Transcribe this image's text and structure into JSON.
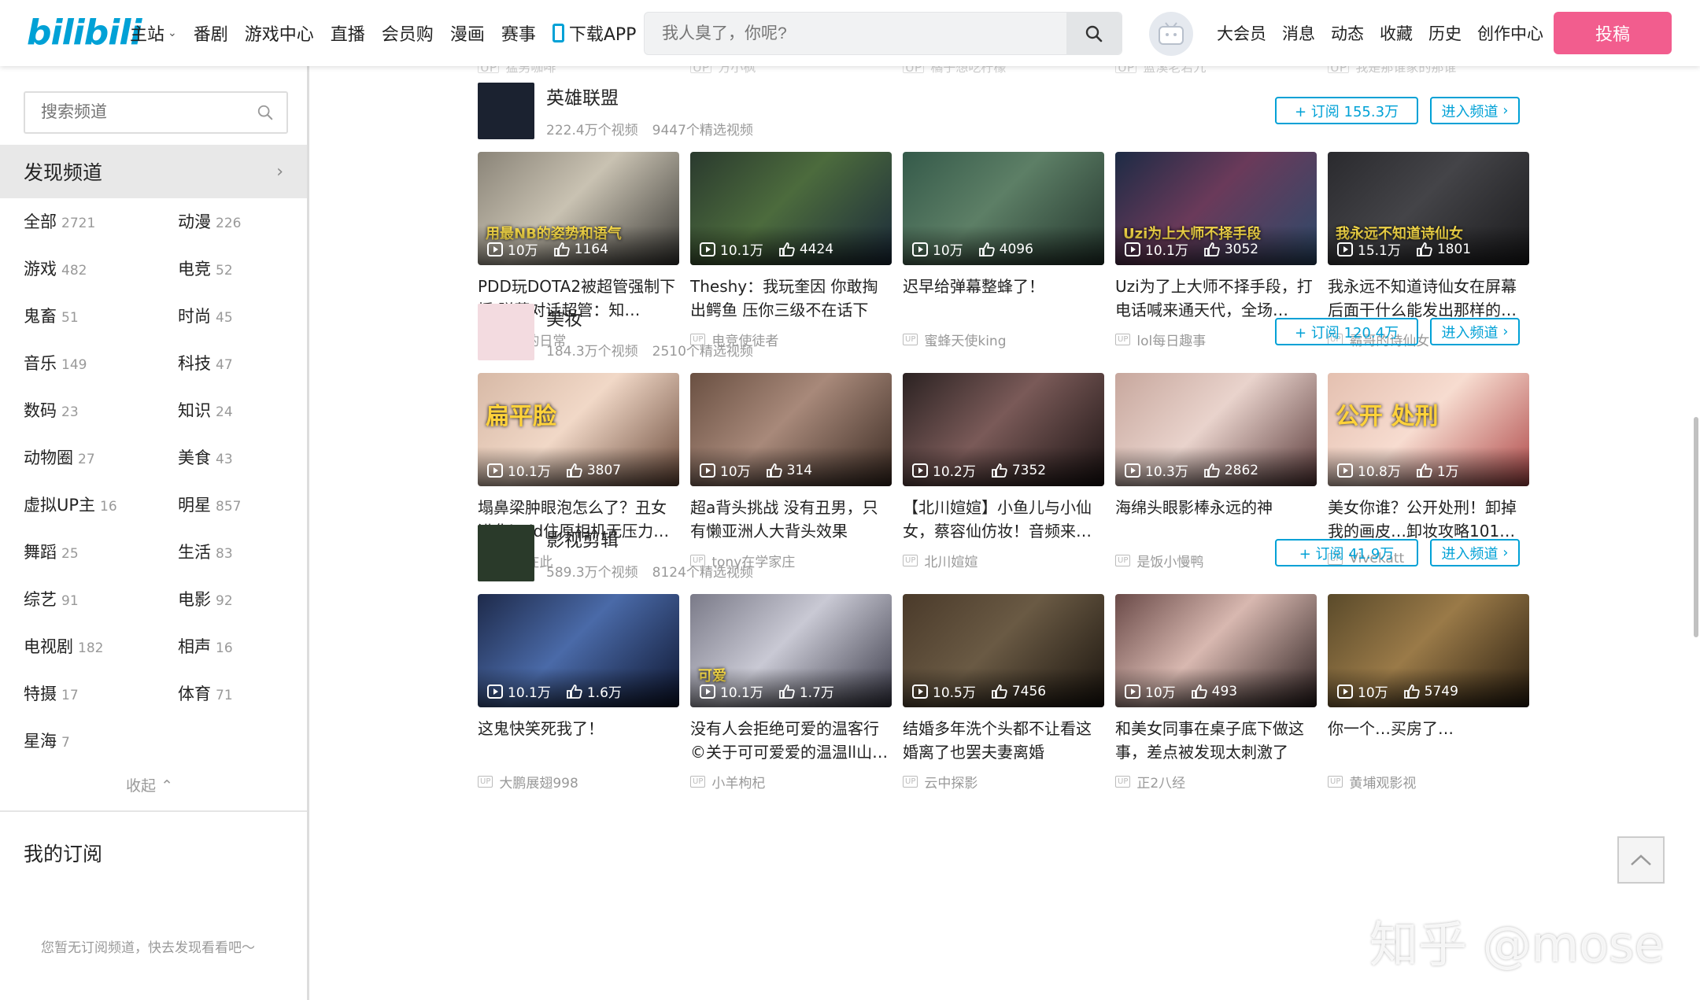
{
  "header": {
    "logo": "bilibili",
    "nav": [
      {
        "label": "主站",
        "dropdown": true
      },
      {
        "label": "番剧"
      },
      {
        "label": "游戏中心"
      },
      {
        "label": "直播"
      },
      {
        "label": "会员购"
      },
      {
        "label": "漫画"
      },
      {
        "label": "赛事"
      },
      {
        "label": "下载APP"
      }
    ],
    "search_placeholder": "我人臭了，你呢?",
    "right_nav": [
      "大会员",
      "消息",
      "动态",
      "收藏",
      "历史",
      "创作中心"
    ],
    "upload_label": "投稿",
    "upload_color": "#f25d8e",
    "accent_color": "#00a1d6"
  },
  "sidebar": {
    "search_placeholder": "搜索频道",
    "discover_label": "发现频道",
    "categories": [
      {
        "name": "全部",
        "count": "2721"
      },
      {
        "name": "动漫",
        "count": "226"
      },
      {
        "name": "游戏",
        "count": "482"
      },
      {
        "name": "电竞",
        "count": "52"
      },
      {
        "name": "鬼畜",
        "count": "51"
      },
      {
        "name": "时尚",
        "count": "45"
      },
      {
        "name": "音乐",
        "count": "149"
      },
      {
        "name": "科技",
        "count": "47"
      },
      {
        "name": "数码",
        "count": "23"
      },
      {
        "name": "知识",
        "count": "24"
      },
      {
        "name": "动物圈",
        "count": "27"
      },
      {
        "name": "美食",
        "count": "43"
      },
      {
        "name": "虚拟UP主",
        "count": "16"
      },
      {
        "name": "明星",
        "count": "857"
      },
      {
        "name": "舞蹈",
        "count": "25"
      },
      {
        "name": "生活",
        "count": "83"
      },
      {
        "name": "综艺",
        "count": "91"
      },
      {
        "name": "电影",
        "count": "92"
      },
      {
        "name": "电视剧",
        "count": "182"
      },
      {
        "name": "相声",
        "count": "16"
      },
      {
        "name": "特摄",
        "count": "17"
      },
      {
        "name": "体育",
        "count": "71"
      },
      {
        "name": "星海",
        "count": "7"
      }
    ],
    "collapse_label": "收起",
    "my_sub_label": "我的订阅",
    "no_sub_text": "您暂无订阅频道，快去发现看看吧～"
  },
  "top_partial_uploaders": [
    "猛男咖啡",
    "方小枫",
    "橘子想吃柠檬",
    "蓝溪老若九",
    "我是那谁家的那谁"
  ],
  "channels": [
    {
      "name": "英雄联盟",
      "videos_count": "222.4万个视频",
      "featured_count": "9447个精选视频",
      "subscribe_label": "+ 订阅 155.3万",
      "enter_label": "进入频道",
      "videos": [
        {
          "views": "10万",
          "likes": "1164",
          "title": "PDD玩DOTA2被超管强制下播 弹幕对话超管：知…",
          "up": "猪酱的日常",
          "caption": "用最NB的姿势和语气"
        },
        {
          "views": "10.1万",
          "likes": "4424",
          "title": "Theshy：我玩奎因 你敢掏出鳄鱼 压你三级不在话下",
          "up": "电竞使徒者",
          "caption": ""
        },
        {
          "views": "10万",
          "likes": "4096",
          "title": "迟早给弹幕整蜂了！",
          "up": "蜜蜂天使king",
          "caption": ""
        },
        {
          "views": "10.1万",
          "likes": "3052",
          "title": "Uzi为了上大师不择手段，打电话喊来通天代，全场…",
          "up": "lol每日趣事",
          "caption": "Uzi为上大师不择手段"
        },
        {
          "views": "15.1万",
          "likes": "1801",
          "title": "我永远不知道诗仙女在屏幕后面干什么能发出那样的…",
          "up": "霸哥的诗仙女",
          "caption": "我永远不知道诗仙女"
        }
      ]
    },
    {
      "name": "美妆",
      "videos_count": "184.3万个视频",
      "featured_count": "2510个精选视频",
      "subscribe_label": "+ 订阅 120.4万",
      "enter_label": "进入频道",
      "videos": [
        {
          "views": "10.1万",
          "likes": "3807",
          "title": "塌鼻梁肿眼泡怎么了？丑女进化hold住原相机无压力…",
          "up": "秀芹在此",
          "caption": "扁平脸"
        },
        {
          "views": "10万",
          "likes": "314",
          "title": "超a背头挑战 没有丑男，只有懒亚洲人大背头效果",
          "up": "tony在学家庄",
          "caption": ""
        },
        {
          "views": "10.2万",
          "likes": "7352",
          "title": "【北川媗媗】小鱼儿与小仙女，蔡容仙仿妆！音频来…",
          "up": "北川媗媗",
          "caption": ""
        },
        {
          "views": "10.3万",
          "likes": "2862",
          "title": "海绵头眼影棒永远的神",
          "up": "是饭小慢鸭",
          "caption": ""
        },
        {
          "views": "10.8万",
          "likes": "1万",
          "title": "美女你谁？公开处刑！卸掉我的画皮…卸妆攻略101…",
          "up": "Vivekatt",
          "caption": "公开 处刑"
        }
      ]
    },
    {
      "name": "影视剪辑",
      "videos_count": "589.3万个视频",
      "featured_count": "8124个精选视频",
      "subscribe_label": "+ 订阅 41.9万",
      "enter_label": "进入频道",
      "videos": [
        {
          "views": "10.1万",
          "likes": "1.6万",
          "title": "这鬼快笑死我了！",
          "up": "大鹏展翅998",
          "caption": ""
        },
        {
          "views": "10.1万",
          "likes": "1.7万",
          "title": "没有人会拒绝可爱的温客行©关于可可爱爱的温温ll山…",
          "up": "小羊枸杞",
          "caption": "可爱"
        },
        {
          "views": "10.5万",
          "likes": "7456",
          "title": "结婚多年洗个头都不让看这婚离了也罢夫妻离婚",
          "up": "云中探影",
          "caption": ""
        },
        {
          "views": "10万",
          "likes": "493",
          "title": "和美女同事在桌子底下做这事，差点被发现太刺激了",
          "up": "正2八经",
          "caption": ""
        },
        {
          "views": "10万",
          "likes": "5749",
          "title": "你一个…买房了…",
          "up": "黄埔观影视",
          "caption": ""
        }
      ]
    }
  ],
  "watermark": "知乎 @mose"
}
